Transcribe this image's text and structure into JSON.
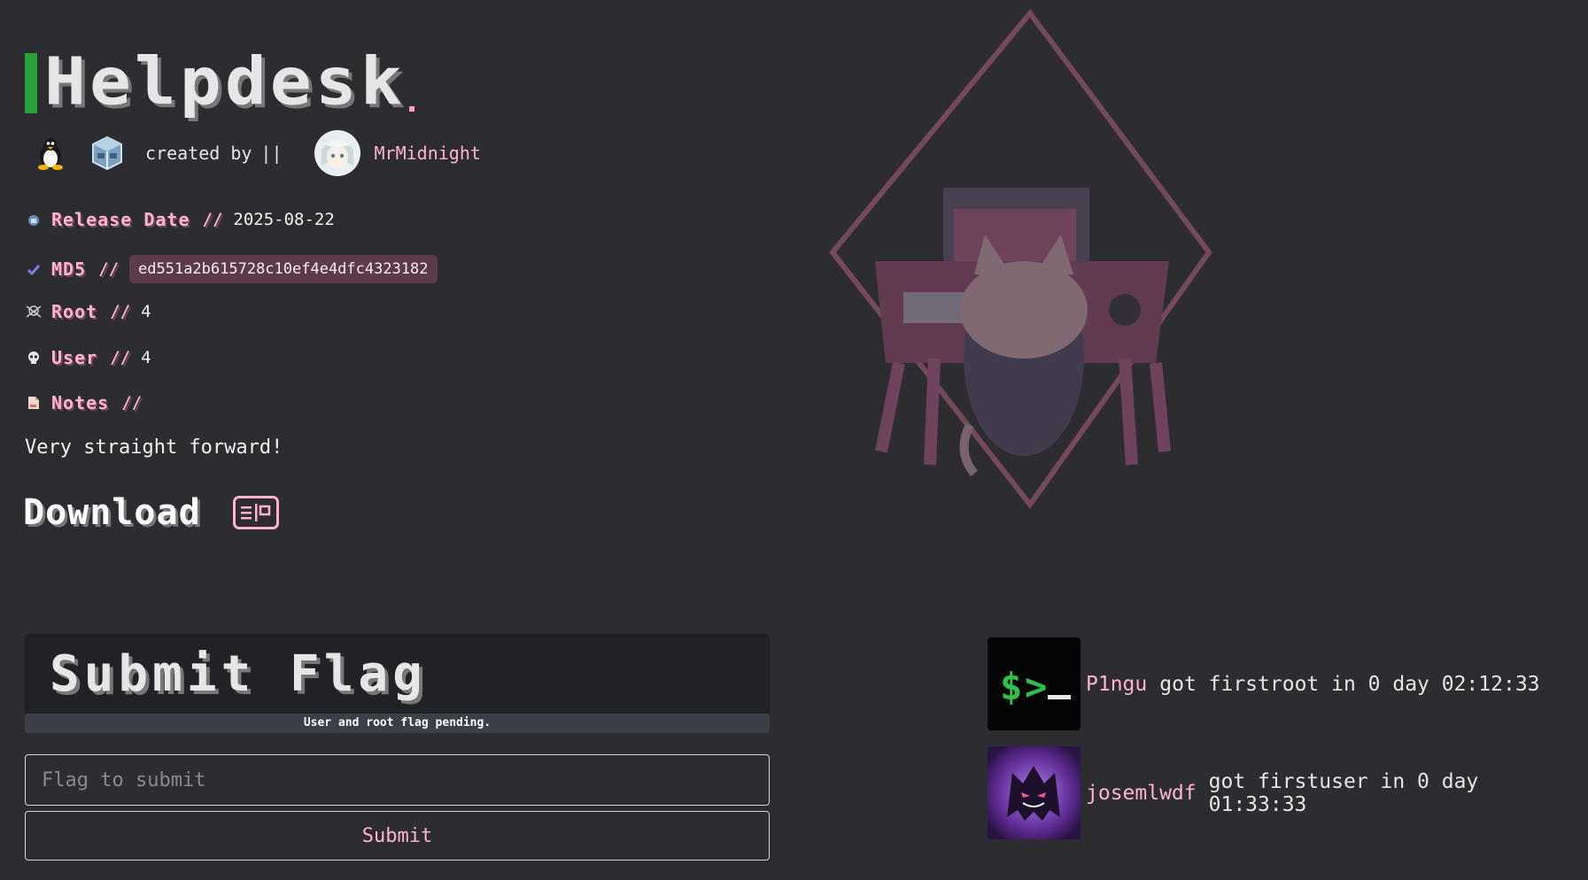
{
  "header": {
    "title": "Helpdesk",
    "created_by_label": "created by",
    "separator": "||",
    "author": "MrMidnight",
    "os_icon": "linux-penguin-icon",
    "platform_icon": "virtualbox-icon"
  },
  "meta": {
    "release": {
      "label": "Release Date",
      "sep": "//",
      "value": "2025-08-22",
      "icon": "calendar-icon"
    },
    "md5": {
      "label": "MD5",
      "sep": "//",
      "value": "ed551a2b615728c10ef4e4dfc4323182",
      "icon": "check-icon"
    },
    "root": {
      "label": "Root",
      "sep": "//",
      "value": "4",
      "icon": "skull-crossbones-icon"
    },
    "user": {
      "label": "User",
      "sep": "//",
      "value": "4",
      "icon": "skull-icon"
    },
    "notes": {
      "label": "Notes",
      "sep": "//",
      "value": "Very straight forward!",
      "icon": "note-icon"
    }
  },
  "download": {
    "label": "Download",
    "icon": "download-card-icon"
  },
  "flag": {
    "title": "Submit Flag",
    "status": "User and root flag pending.",
    "placeholder": "Flag to submit",
    "submit_label": "Submit"
  },
  "bloods": [
    {
      "user": "P1ngu",
      "text": "got firstroot in 0 day 02:12:33",
      "avatar": "terminal-avatar"
    },
    {
      "user": "josemlwdf",
      "text": "got firstuser in 0 day 01:33:33",
      "avatar": "ghost-avatar"
    }
  ],
  "colors": {
    "background": "#2c2c31",
    "accent_pink": "#ffb3d1",
    "title_bar_green": "#29a23c",
    "md5_badge": "#5d3a4a"
  }
}
